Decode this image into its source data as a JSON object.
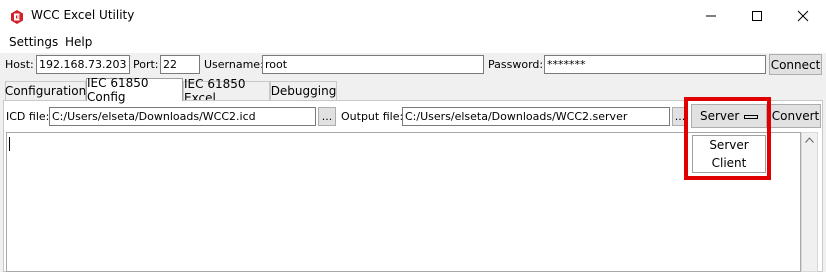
{
  "window": {
    "title": "WCC Excel Utility"
  },
  "menu": [
    {
      "label": "Settings"
    },
    {
      "label": "Help"
    }
  ],
  "connection": {
    "host_label": "Host:",
    "host_value": "192.168.73.203",
    "port_label": "Port:",
    "port_value": "22",
    "username_label": "Username:",
    "username_value": "root",
    "password_label": "Password:",
    "password_value": "*******",
    "connect_label": "Connect"
  },
  "tabs": [
    {
      "label": "Configuration"
    },
    {
      "label": "IEC 61850 Config",
      "active": true
    },
    {
      "label": "IEC 61850 Excel"
    },
    {
      "label": "Debugging"
    }
  ],
  "config": {
    "icd_label": "ICD file:",
    "icd_value": "C:/Users/elseta/Downloads/WCC2.icd",
    "browse_label": "...",
    "output_label": "Output file:",
    "output_value": "C:/Users/elseta/Downloads/WCC2.server",
    "mode_selected": "Server",
    "mode_options": [
      "Server",
      "Client"
    ],
    "convert_label": "Convert"
  },
  "colors": {
    "highlight": "#e00000",
    "window_bg": "#f0f0f0"
  },
  "icons": {
    "app": "wcc-logo-icon",
    "minimize": "minimize-icon",
    "maximize": "maximize-icon",
    "close": "close-icon"
  }
}
